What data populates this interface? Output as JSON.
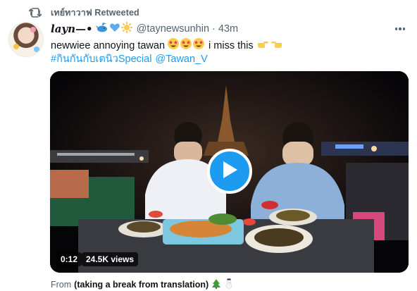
{
  "retweet": {
    "label": "เทย์ทาวาฟ Retweeted",
    "icon": "retweet-icon"
  },
  "tweet": {
    "display_name": "𝒍𝒂𝒚𝒏—•",
    "name_emojis": [
      "whale-icon",
      "blue-heart-icon",
      "sun-icon"
    ],
    "handle": "@taynewsunhin",
    "separator": "·",
    "time": "43m",
    "text": "newwiee annoying tawan",
    "star_eyes_count": 3,
    "text_tail": "i miss this",
    "hashtag": "#กินกันกับเตนิวSpecial",
    "mention": "@Tawan_V",
    "more_icon": "more-options-icon"
  },
  "video": {
    "timestamp": "0:12",
    "views": "24.5K views",
    "play_icon": "play-icon"
  },
  "source": {
    "prefix": "From",
    "app": "(taking a break from translation)",
    "emojis": [
      "christmas-tree-icon",
      "snowman-icon"
    ]
  },
  "colors": {
    "accent": "#1d9bf0",
    "secondary_text": "#536471",
    "primary_text": "#0f1419"
  }
}
